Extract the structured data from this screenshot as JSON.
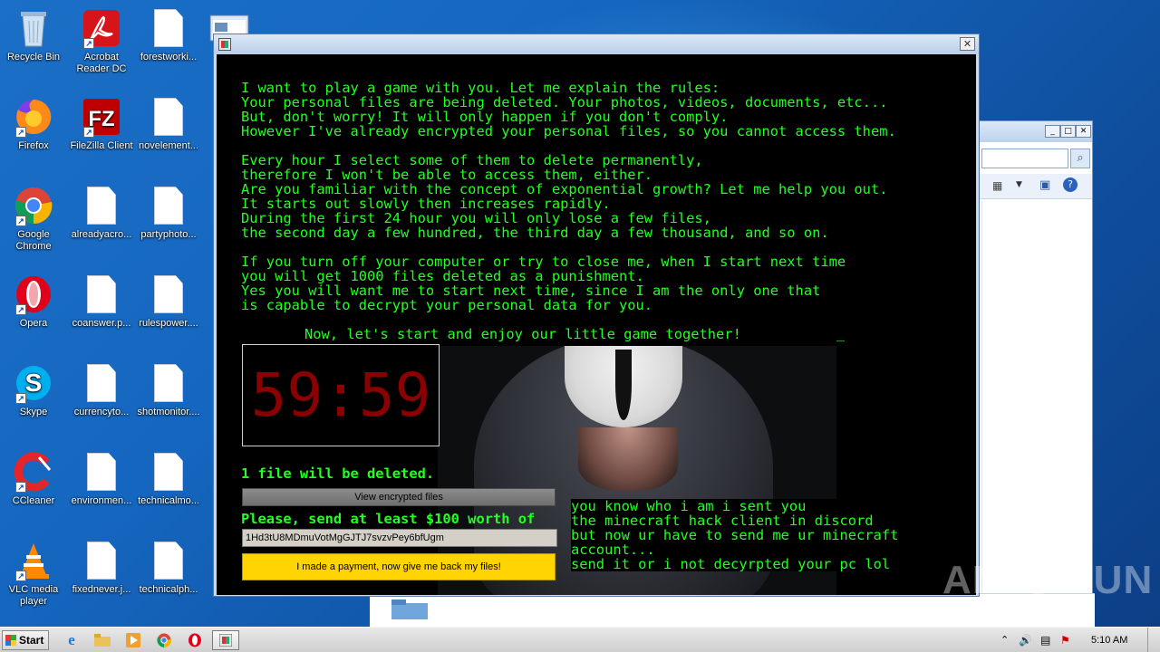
{
  "desktop": {
    "icons": [
      {
        "label": "Recycle Bin"
      },
      {
        "label": "Acrobat Reader DC"
      },
      {
        "label": "forestworki..."
      },
      {
        "label": "Firefox"
      },
      {
        "label": "FileZilla Client"
      },
      {
        "label": "novelement..."
      },
      {
        "label": "Google Chrome"
      },
      {
        "label": "alreadyacro..."
      },
      {
        "label": "partyphoto..."
      },
      {
        "label": "Opera"
      },
      {
        "label": "coanswer.p..."
      },
      {
        "label": "rulespower...."
      },
      {
        "label": "Skype"
      },
      {
        "label": "currencyto..."
      },
      {
        "label": "shotmonitor...."
      },
      {
        "label": "CCleaner"
      },
      {
        "label": "environmen..."
      },
      {
        "label": "technicalmo..."
      },
      {
        "label": "VLC media player"
      },
      {
        "label": "fixednever.j..."
      },
      {
        "label": "technicalph..."
      }
    ]
  },
  "ransom_window": {
    "message_lines": {
      "p1": "I want to play a game with you. Let me explain the rules:\nYour personal files are being deleted. Your photos, videos, documents, etc...\nBut, don't worry! It will only happen if you don't comply.\nHowever I've already encrypted your personal files, so you cannot access them.",
      "p2": "Every hour I select some of them to delete permanently,\ntherefore I won't be able to access them, either.\nAre you familiar with the concept of exponential growth? Let me help you out.\nIt starts out slowly then increases rapidly.\nDuring the first 24 hour you will only lose a few files,\nthe second day a few hundred, the third day a few thousand, and so on.",
      "p3": "If you turn off your computer or try to close me, when I start next time\nyou will get 1000 files deleted as a punishment.\nYes you will want me to start next time, since I am the only one that\nis capable to decrypt your personal data for you.",
      "p4": "Now, let's start and enjoy our little game together!"
    },
    "cursor": "_",
    "timer": "59:59",
    "files_deleted_text": "1 file will be deleted.",
    "view_files_button": "View encrypted files",
    "send_text": "Please, send at least $100 worth of",
    "wallet_address": "1Hd3tU8MDmuVotMgGJTJ7svzvPey6bfUgm",
    "payment_button": "I made a payment, now give me back my files!",
    "note_text": "you know who i am i sent you\nthe minecraft hack client in discord\nbut now ur have to send me ur minecraft\naccount...\nsend it or i not decyrpted your pc lol",
    "close_glyph": "✕"
  },
  "watermark": {
    "left": "ANY",
    "right": "RUN"
  },
  "taskbar": {
    "start_label": "Start",
    "clock": "5:10 AM"
  },
  "colors": {
    "terminal_green": "#22ff22",
    "timer_red": "#8b0000",
    "pay_button": "#ffd400"
  }
}
